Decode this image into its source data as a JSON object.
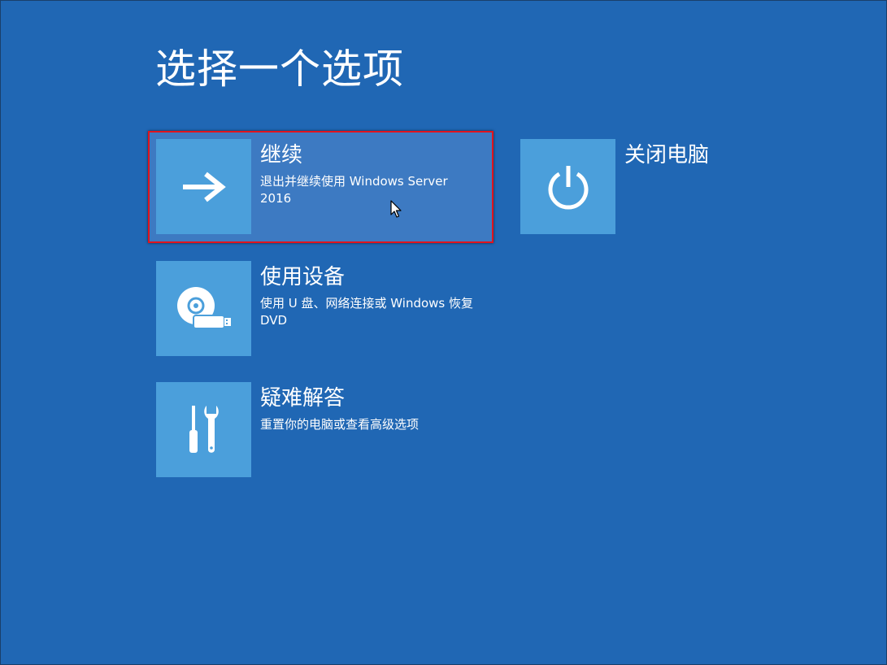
{
  "page": {
    "title": "选择一个选项"
  },
  "options": [
    {
      "id": "continue",
      "title": "继续",
      "description": "退出并继续使用 Windows Server 2016",
      "icon": "arrow-right-icon",
      "selected": true
    },
    {
      "id": "use-device",
      "title": "使用设备",
      "description": "使用 U 盘、网络连接或 Windows 恢复 DVD",
      "icon": "disc-usb-icon",
      "selected": false
    },
    {
      "id": "troubleshoot",
      "title": "疑难解答",
      "description": "重置你的电脑或查看高级选项",
      "icon": "tools-icon",
      "selected": false
    },
    {
      "id": "shutdown",
      "title": "关闭电脑",
      "description": "",
      "icon": "power-icon",
      "selected": false
    }
  ],
  "colors": {
    "background": "#2067b4",
    "tile": "#4b9fdb",
    "selected_fill": "#3d7ac2",
    "selection_border": "#e0141e",
    "text": "#ffffff"
  }
}
